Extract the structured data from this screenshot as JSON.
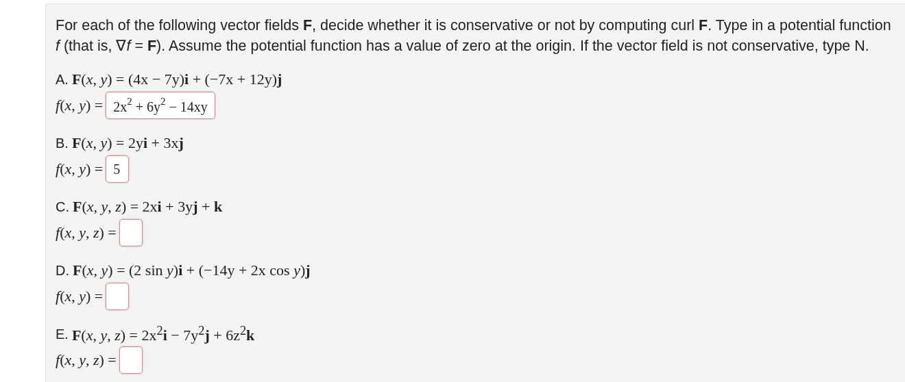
{
  "instructions": "For each of the following vector fields **F**, decide whether it is conservative or not by computing curl **F**. Type in a potential function *f* (that is, ∇*f* = **F**). Assume the potential function has a value of zero at the origin. If the vector field is not conservative, type N.",
  "parts": [
    {
      "label": "A.",
      "field": "**F**(*x*, *y*) = (4x − 7y)**i** + (−7x + 12y)**j**",
      "potential": "*f*(*x*, *y*) =",
      "value": "2x$^{2}$ + 6y$^{2}$ − 14xy"
    },
    {
      "label": "B.",
      "field": "**F**(*x*, *y*) = 2y**i** + 3x**j**",
      "potential": "*f*(*x*, *y*) =",
      "value": "5"
    },
    {
      "label": "C.",
      "field": "**F**(*x*, *y*, *z*) = 2x**i** + 3y**j** + **k**",
      "potential": "*f*(*x*, *y*, *z*) ="
    },
    {
      "label": "D.",
      "field": "**F**(*x*, *y*) = (2 sin *y*)**i** + (−14y + 2x cos *y*)**j**",
      "potential": "*f*(*x*, *y*) ="
    },
    {
      "label": "E.",
      "field": "**F**(*x*, *y*, *z*) = 2x$^{2}$**i** − 7y$^{2}$**j** + 6z$^{2}$**k**",
      "potential": "*f*(*x*, *y*, *z*) ="
    }
  ]
}
